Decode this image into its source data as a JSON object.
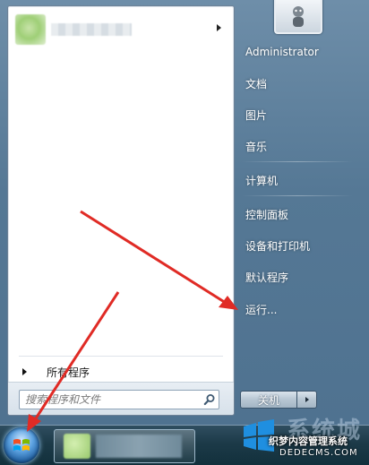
{
  "left_pane": {
    "all_programs_label": "所有程序",
    "search_placeholder": "搜索程序和文件"
  },
  "right_pane": {
    "items": [
      "Administrator",
      "文档",
      "图片",
      "音乐",
      "计算机",
      "控制面板",
      "设备和打印机",
      "默认程序",
      "运行..."
    ]
  },
  "shutdown": {
    "label": "关机"
  },
  "watermark": {
    "big": "系统城",
    "cn": "织梦内容管理系统",
    "en": "DEDECMS.COM"
  },
  "colors": {
    "arrow": "#e02b25",
    "menu_top": "#6e8ea9",
    "taskbar": "#1c3a48"
  },
  "icons": {
    "start": "windows-logo-icon",
    "search": "search-magnifier-icon",
    "user": "user-avatar-icon",
    "shutdown_options": "arrow-right-icon",
    "pinned_expand": "arrow-right-icon",
    "all_programs": "arrow-right-icon"
  }
}
